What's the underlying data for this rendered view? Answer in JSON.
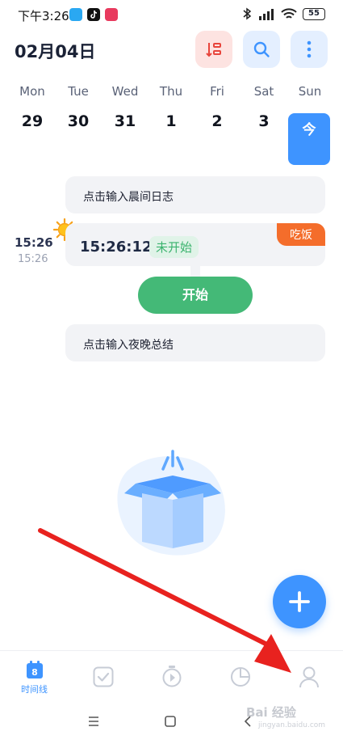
{
  "status_bar": {
    "time": "下午3:26",
    "battery": "55"
  },
  "header": {
    "date_title": "02月04日"
  },
  "week": {
    "days": [
      "Mon",
      "Tue",
      "Wed",
      "Thu",
      "Fri",
      "Sat",
      "Sun"
    ],
    "dates": [
      "29",
      "30",
      "31",
      "1",
      "2",
      "3",
      ""
    ],
    "today_label": "今"
  },
  "timeline": {
    "morning_placeholder": "点击输入晨间日志",
    "event": {
      "time_left": "15:26",
      "time_left_sub": "15:26",
      "time": "15:26:12",
      "status": "未开始",
      "tag": "吃饭"
    },
    "start_button": "开始",
    "evening_placeholder": "点击输入夜晚总结"
  },
  "bottom_nav": {
    "items": [
      {
        "label": "时间线",
        "icon": "calendar-icon",
        "badge": "8",
        "active": true
      },
      {
        "label": "",
        "icon": "checkbox-icon"
      },
      {
        "label": "",
        "icon": "timer-icon"
      },
      {
        "label": "",
        "icon": "pie-chart-icon"
      },
      {
        "label": "",
        "icon": "profile-icon"
      }
    ]
  },
  "watermark": {
    "text": "Bai 经验",
    "sub": "jingyan.baidu.com"
  },
  "colors": {
    "accent": "#3e94ff",
    "start": "#44b977",
    "tag": "#f46d2b",
    "annotation_arrow": "#e8221f"
  }
}
